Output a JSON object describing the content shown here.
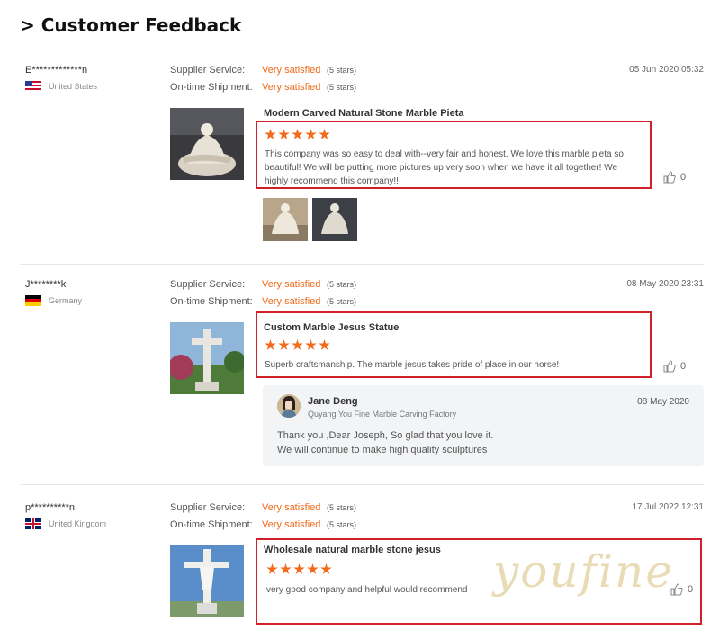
{
  "page": {
    "title": "> Customer Feedback"
  },
  "labels": {
    "supplier_service": "Supplier Service:",
    "ontime_shipment": "On-time Shipment:"
  },
  "reviews": [
    {
      "reviewer": "E*************n",
      "country": "United States",
      "supplier_rating": "Very satisfied",
      "supplier_stars": "(5 stars)",
      "shipment_rating": "Very satisfied",
      "shipment_stars": "(5 stars)",
      "date": "05 Jun 2020 05:32",
      "product": "Modern Carved Natural Stone Marble Pieta",
      "stars": 5,
      "text": "This company was so easy to deal with--very fair and honest.  We love this marble pieta so beautiful!  We will be putting more pictures up very soon when we have it all together!  We highly recommend this company!!",
      "likes": "0"
    },
    {
      "reviewer": "J********k",
      "country": "Germany",
      "supplier_rating": "Very satisfied",
      "supplier_stars": "(5 stars)",
      "shipment_rating": "Very satisfied",
      "shipment_stars": "(5 stars)",
      "date": "08 May 2020 23:31",
      "product": "Custom Marble Jesus Statue",
      "stars": 5,
      "text": "Superb craftsmanship. The marble jesus takes pride of place in our horse!",
      "likes": "0",
      "reply": {
        "name": "Jane Deng",
        "company": "Quyang You Fine Marble Carving Factory",
        "date": "08 May 2020",
        "line1": "Thank you ,Dear Joseph, So glad that you love it.",
        "line2": "We will continue to make high quality sculptures"
      }
    },
    {
      "reviewer": "p**********n",
      "country": "United Kingdom",
      "supplier_rating": "Very satisfied",
      "supplier_stars": "(5 stars)",
      "shipment_rating": "Very satisfied",
      "shipment_stars": "(5 stars)",
      "date": "17 Jul 2022 12:31",
      "product": "Wholesale natural marble stone jesus",
      "stars": 5,
      "text": "very good company and helpful would recommend",
      "likes": "0"
    }
  ],
  "watermark": "youfine",
  "colors": {
    "accent_orange": "#f06a1a",
    "highlight_red": "#d0202a",
    "star": "#f26b1d"
  }
}
